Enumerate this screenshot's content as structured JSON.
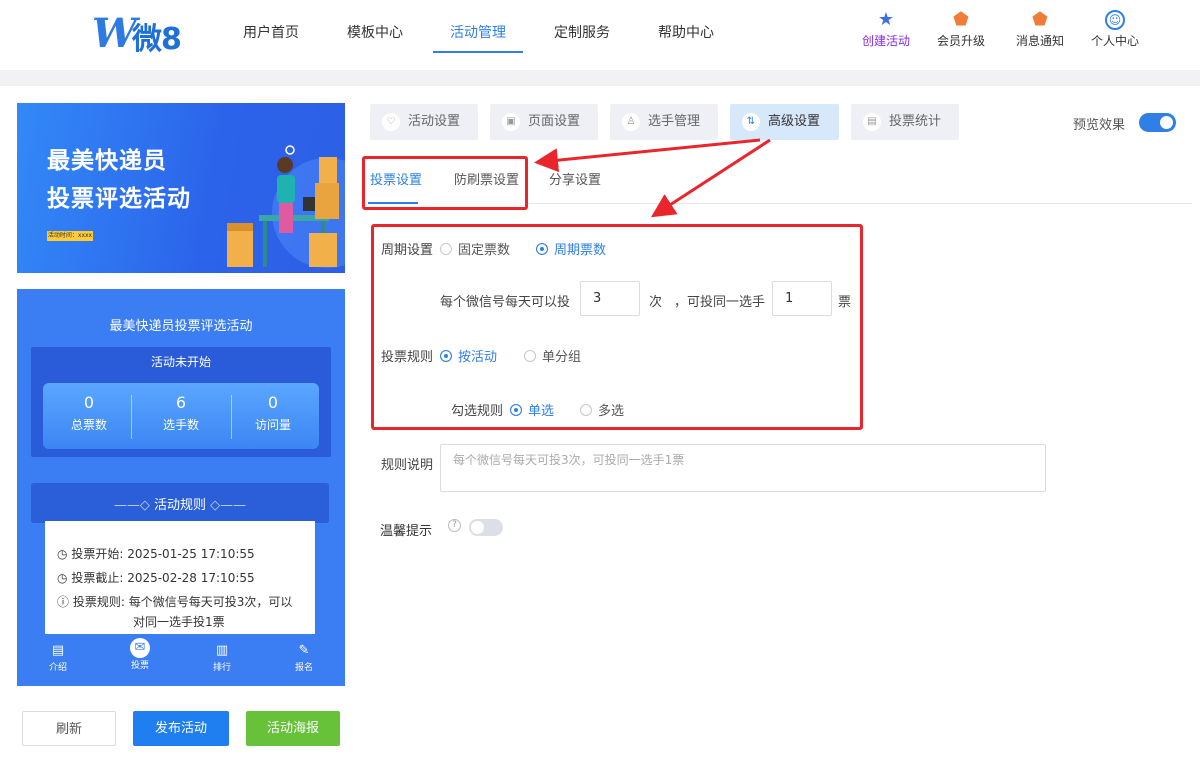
{
  "header": {
    "logo_text": "微8",
    "nav": [
      "用户首页",
      "模板中心",
      "活动管理",
      "定制服务",
      "帮助中心"
    ],
    "active_nav": "活动管理",
    "icons": [
      {
        "label": "创建活动",
        "icon": "star-icon",
        "color": "#8a2be2"
      },
      {
        "label": "会员升级",
        "icon": "badge-icon",
        "color": "#f07c3a"
      },
      {
        "label": "消息通知",
        "icon": "bell-badge-icon",
        "color": "#f07c3a"
      },
      {
        "label": "个人中心",
        "icon": "user-icon",
        "color": "#2f7fe6"
      }
    ]
  },
  "preview": {
    "banner_line1": "最美快递员",
    "banner_line2": "投票评选活动",
    "banner_tag": "活动时间：xxxx",
    "activity_title": "最美快递员投票评选活动",
    "status": "活动未开始",
    "stats": [
      {
        "num": "0",
        "label": "总票数"
      },
      {
        "num": "6",
        "label": "选手数"
      },
      {
        "num": "0",
        "label": "访问量"
      }
    ],
    "rules_title": "活动规则",
    "rules": [
      {
        "key": "投票开始:",
        "value": "2025-01-25 17:10:55"
      },
      {
        "key": "投票截止:",
        "value": "2025-02-28 17:10:55"
      },
      {
        "key": "投票规则:",
        "value": "每个微信号每天可投3次，可以",
        "value2": "对同一选手投1票"
      }
    ],
    "tabs": [
      "介绍",
      "投票",
      "排行",
      "报名"
    ]
  },
  "buttons": {
    "refresh": "刷新",
    "publish": "发布活动",
    "poster": "活动海报"
  },
  "top_tabs": [
    "活动设置",
    "页面设置",
    "选手管理",
    "高级设置",
    "投票统计"
  ],
  "active_top_tab": "高级设置",
  "preview_effect": {
    "label": "预览效果",
    "on": true
  },
  "sub_tabs": [
    "投票设置",
    "防刷票设置",
    "分享设置"
  ],
  "active_sub_tab": "投票设置",
  "form": {
    "cycle_label": "周期设置",
    "cycle_options": [
      "固定票数",
      "周期票数"
    ],
    "cycle_selected": "周期票数",
    "per_day_prefix": "每个微信号每天可以投",
    "per_day_value": "3",
    "per_day_unit": "次",
    "same_player_prefix": "，可投同一选手",
    "same_player_value": "1",
    "same_player_unit": "票",
    "vote_rule_label": "投票规则",
    "vote_rule_options": [
      "按活动",
      "单分组"
    ],
    "vote_rule_selected": "按活动",
    "check_rule_label": "勾选规则",
    "check_rule_options": [
      "单选",
      "多选"
    ],
    "check_rule_selected": "单选",
    "rule_desc_label": "规则说明",
    "rule_desc_placeholder": "每个微信号每天可投3次，可投同一选手1票",
    "warm_tip_label": "温馨提示",
    "warm_tip_on": false
  },
  "colors": {
    "accent": "#2f7fe6",
    "annotation": "#e8262b",
    "publish": "#1f7ef0",
    "poster": "#67c23a"
  }
}
